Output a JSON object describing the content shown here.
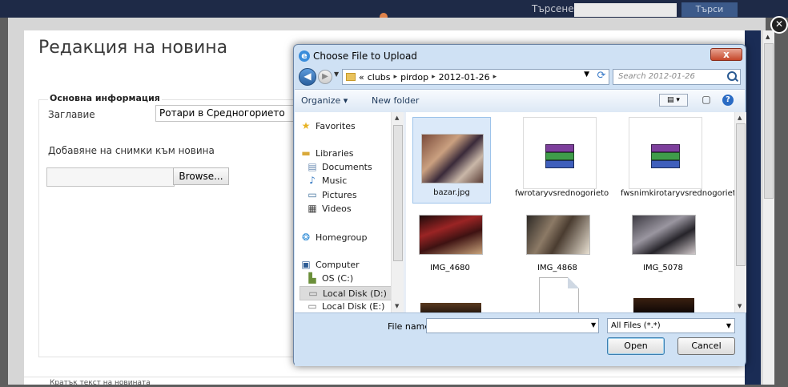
{
  "site": {
    "search_label": "Търсене:",
    "search_button": "Търси",
    "page_title": "Редакция на новина",
    "section_basic": "Основна информация",
    "title_label": "Заглавие",
    "title_value": "Ротари в Средногорието",
    "photos_label": "Добавяне на снимки към новина",
    "browse_label": "Browse...",
    "bottom_section": "Кратък текст на новината"
  },
  "dialog": {
    "title": "Choose File to Upload",
    "close_label": "x",
    "address": {
      "prefix": "«",
      "crumbs": [
        "clubs",
        "pirdop",
        "2012-01-26"
      ]
    },
    "search_placeholder": "Search 2012-01-26",
    "toolbar": {
      "organize": "Organize ▾",
      "new_folder": "New folder"
    },
    "nav": {
      "favorites": "Favorites",
      "libraries": "Libraries",
      "documents": "Documents",
      "music": "Music",
      "pictures": "Pictures",
      "videos": "Videos",
      "homegroup": "Homegroup",
      "computer": "Computer",
      "os_c": "OS (C:)",
      "local_d": "Local Disk (D:)",
      "local_e": "Local Disk (E:)"
    },
    "files": [
      {
        "name": "bazar.jpg",
        "type": "image"
      },
      {
        "name": "fwrotaryvsrednogorieto",
        "type": "rar"
      },
      {
        "name": "fwsnimkirotaryvsrednogorieto",
        "type": "rar"
      },
      {
        "name": "IMG_4680",
        "type": "image"
      },
      {
        "name": "IMG_4868",
        "type": "image"
      },
      {
        "name": "IMG_5078",
        "type": "image"
      }
    ],
    "file_name_label": "File name:",
    "file_name_value": "",
    "file_type": "All Files (*.*)",
    "open_label": "Open",
    "cancel_label": "Cancel"
  }
}
